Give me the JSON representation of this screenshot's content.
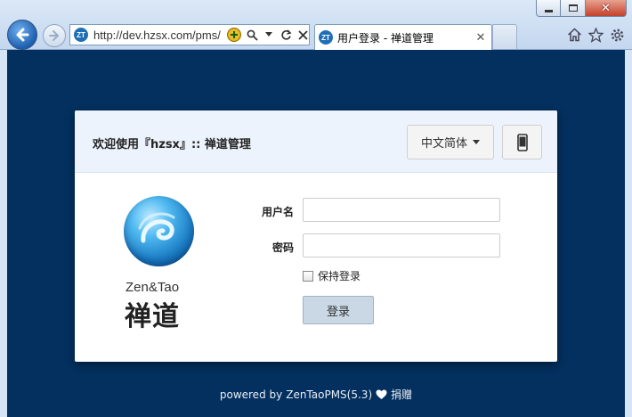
{
  "browser": {
    "address_url": "http://dev.hzsx.com/pms/",
    "favicon_text": "ZT",
    "tab_title": "用户登录 - 禅道管理"
  },
  "login": {
    "welcome_title": "欢迎使用『hzsx』:: 禅道管理",
    "language_label": "中文简体",
    "username_label": "用户名",
    "username_value": "",
    "password_label": "密码",
    "password_value": "",
    "keep_login_label": "保持登录",
    "submit_label": "登录"
  },
  "logo": {
    "word": "Zen&Tao",
    "chinese": "禅道"
  },
  "footer": {
    "powered_by": "powered by",
    "product": "ZenTaoPMS(5.3)",
    "donate": "捐赠"
  },
  "colors": {
    "page_bg": "#03305f",
    "card_header_bg": "#edf3fd",
    "submit_bg": "#c9d8e4"
  }
}
